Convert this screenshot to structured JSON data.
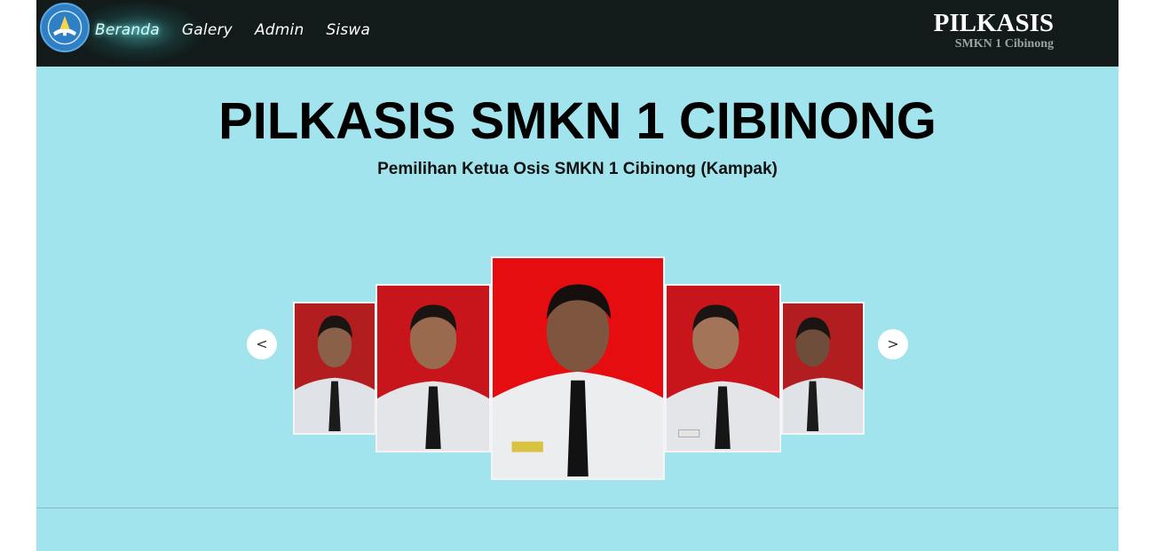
{
  "navbar": {
    "links": [
      {
        "label": "Beranda"
      },
      {
        "label": "Galery"
      },
      {
        "label": "Admin"
      },
      {
        "label": "Siswa"
      }
    ],
    "brand_title": "PILKASIS",
    "brand_subtitle": "SMKN 1 Cibinong"
  },
  "hero": {
    "title": "PILKASIS SMKN 1 CIBINONG",
    "subtitle": "Pemilihan Ketua Osis SMKN 1 Cibinong (Kampak)"
  },
  "carousel": {
    "prev_label": "<",
    "next_label": ">"
  },
  "colors": {
    "page_bg": "#a2e4ee",
    "navbar_bg": "#121a1a",
    "photo_bg_red": "#d0141a"
  }
}
